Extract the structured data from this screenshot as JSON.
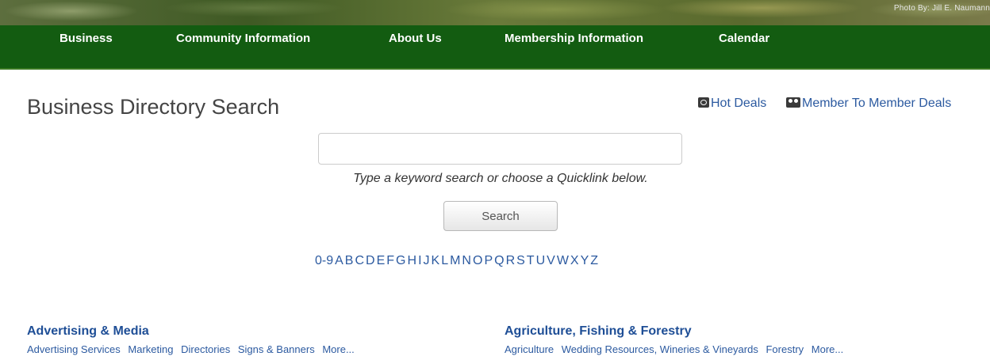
{
  "header": {
    "photo_credit": "Photo By:  Jill E. Naumann",
    "nav": [
      {
        "label": "Business"
      },
      {
        "label": "Community Information"
      },
      {
        "label": "About Us"
      },
      {
        "label": "Membership Information"
      },
      {
        "label": "Calendar"
      }
    ]
  },
  "page": {
    "title": "Business Directory Search",
    "hot_deals": "Hot Deals",
    "member_deals": "Member To Member Deals"
  },
  "search": {
    "value": "",
    "placeholder": "",
    "hint": "Type a keyword search or choose a Quicklink below.",
    "button_label": "Search"
  },
  "alphabet": [
    "0-9",
    "A",
    "B",
    "C",
    "D",
    "E",
    "F",
    "G",
    "H",
    "I",
    "J",
    "K",
    "L",
    "M",
    "N",
    "O",
    "P",
    "Q",
    "R",
    "S",
    "T",
    "U",
    "V",
    "W",
    "X",
    "Y",
    "Z"
  ],
  "categories": [
    {
      "title": "Advertising & Media",
      "links": [
        "Advertising Services",
        "Marketing",
        "Directories",
        "Signs & Banners",
        "More..."
      ]
    },
    {
      "title": "Agriculture, Fishing & Forestry",
      "links": [
        "Agriculture",
        "Wedding Resources, Wineries & Vineyards",
        "Forestry",
        "More..."
      ]
    }
  ]
}
